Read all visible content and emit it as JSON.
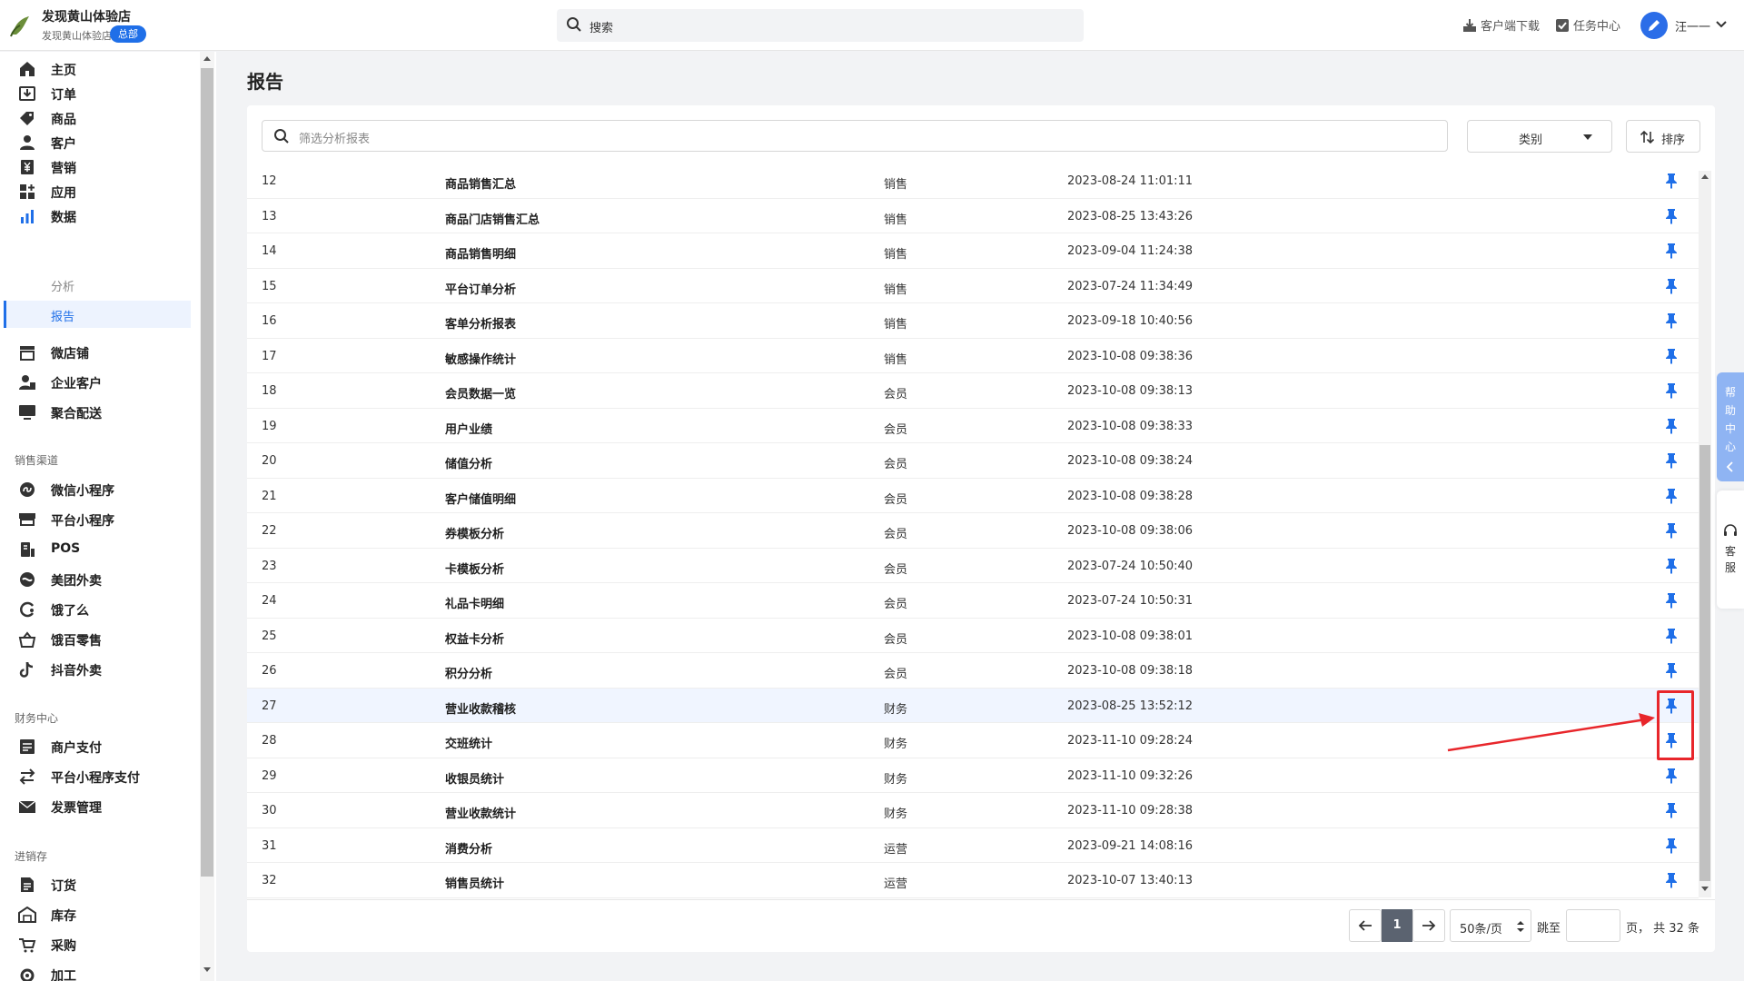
{
  "header": {
    "store_name": "发现黄山体验店",
    "store_sub": "发现黄山体验店",
    "store_badge": "总部",
    "search_placeholder": "搜索",
    "download_label": "客户端下载",
    "task_label": "任务中心",
    "user_name": "汪一一"
  },
  "sidebar": {
    "main_items": [
      {
        "label": "主页",
        "icon": "home-icon"
      },
      {
        "label": "订单",
        "icon": "order-icon"
      },
      {
        "label": "商品",
        "icon": "tag-icon"
      },
      {
        "label": "客户",
        "icon": "user-icon"
      },
      {
        "label": "营销",
        "icon": "yen-icon"
      },
      {
        "label": "应用",
        "icon": "apps-icon"
      },
      {
        "label": "数据",
        "icon": "bar-chart-icon"
      }
    ],
    "sub_items": [
      {
        "label": "分析",
        "active": false
      },
      {
        "label": "报告",
        "active": true
      }
    ],
    "store_items": [
      {
        "label": "微店铺",
        "icon": "store-icon"
      },
      {
        "label": "企业客户",
        "icon": "enterprise-icon"
      },
      {
        "label": "聚合配送",
        "icon": "delivery-icon"
      }
    ],
    "section_sales": "销售渠道",
    "sales_items": [
      {
        "label": "微信小程序",
        "icon": "miniprogram-icon"
      },
      {
        "label": "平台小程序",
        "icon": "platform-icon"
      },
      {
        "label": "POS",
        "icon": "pos-icon"
      },
      {
        "label": "美团外卖",
        "icon": "meituan-icon"
      },
      {
        "label": "饿了么",
        "icon": "eleme-icon"
      },
      {
        "label": "饿百零售",
        "icon": "basket-icon"
      },
      {
        "label": "抖音外卖",
        "icon": "douyin-icon"
      }
    ],
    "section_finance": "财务中心",
    "finance_items": [
      {
        "label": "商户支付",
        "icon": "payment-icon"
      },
      {
        "label": "平台小程序支付",
        "icon": "transfer-icon"
      },
      {
        "label": "发票管理",
        "icon": "invoice-icon"
      }
    ],
    "section_inventory": "进销存",
    "inventory_items": [
      {
        "label": "订货",
        "icon": "purchase-order-icon"
      },
      {
        "label": "库存",
        "icon": "warehouse-icon"
      },
      {
        "label": "采购",
        "icon": "procurement-icon"
      },
      {
        "label": "加工",
        "icon": "processing-icon"
      }
    ]
  },
  "main": {
    "page_title": "报告",
    "filter_placeholder": "筛选分析报表",
    "category_label": "类别",
    "sort_label": "排序",
    "rows": [
      {
        "no": "12",
        "name": "商品销售汇总",
        "category": "销售",
        "time": "2023-08-24 11:01:11"
      },
      {
        "no": "13",
        "name": "商品门店销售汇总",
        "category": "销售",
        "time": "2023-08-25 13:43:26"
      },
      {
        "no": "14",
        "name": "商品销售明细",
        "category": "销售",
        "time": "2023-09-04 11:24:38"
      },
      {
        "no": "15",
        "name": "平台订单分析",
        "category": "销售",
        "time": "2023-07-24 11:34:49"
      },
      {
        "no": "16",
        "name": "客单分析报表",
        "category": "销售",
        "time": "2023-09-18 10:40:56"
      },
      {
        "no": "17",
        "name": "敏感操作统计",
        "category": "销售",
        "time": "2023-10-08 09:38:36"
      },
      {
        "no": "18",
        "name": "会员数据一览",
        "category": "会员",
        "time": "2023-10-08 09:38:13"
      },
      {
        "no": "19",
        "name": "用户业绩",
        "category": "会员",
        "time": "2023-10-08 09:38:33"
      },
      {
        "no": "20",
        "name": "储值分析",
        "category": "会员",
        "time": "2023-10-08 09:38:24"
      },
      {
        "no": "21",
        "name": "客户储值明细",
        "category": "会员",
        "time": "2023-10-08 09:38:28"
      },
      {
        "no": "22",
        "name": "券模板分析",
        "category": "会员",
        "time": "2023-10-08 09:38:06"
      },
      {
        "no": "23",
        "name": "卡模板分析",
        "category": "会员",
        "time": "2023-07-24 10:50:40"
      },
      {
        "no": "24",
        "name": "礼品卡明细",
        "category": "会员",
        "time": "2023-07-24 10:50:31"
      },
      {
        "no": "25",
        "name": "权益卡分析",
        "category": "会员",
        "time": "2023-10-08 09:38:01"
      },
      {
        "no": "26",
        "name": "积分分析",
        "category": "会员",
        "time": "2023-10-08 09:38:18"
      },
      {
        "no": "27",
        "name": "营业收款稽核",
        "category": "财务",
        "time": "2023-08-25 13:52:12"
      },
      {
        "no": "28",
        "name": "交班统计",
        "category": "财务",
        "time": "2023-11-10 09:28:24"
      },
      {
        "no": "29",
        "name": "收银员统计",
        "category": "财务",
        "time": "2023-11-10 09:32:26"
      },
      {
        "no": "30",
        "name": "营业收款统计",
        "category": "财务",
        "time": "2023-11-10 09:28:38"
      },
      {
        "no": "31",
        "name": "消费分析",
        "category": "运营",
        "time": "2023-09-21 14:08:16"
      },
      {
        "no": "32",
        "name": "销售员统计",
        "category": "运营",
        "time": "2023-10-07 13:40:13"
      }
    ],
    "highlighted_row_no": "27"
  },
  "pagination": {
    "current_page": "1",
    "page_size": "50条/页",
    "jump_label": "跳至",
    "total_label": "页，  共 32 条"
  },
  "float": {
    "help_label": "帮助中心",
    "service_label": "客服"
  },
  "colors": {
    "accent": "#1f6fe8",
    "pin": "#1f6fe8",
    "annotation": "#e8262b",
    "highlight_row": "#f0f5ff"
  }
}
